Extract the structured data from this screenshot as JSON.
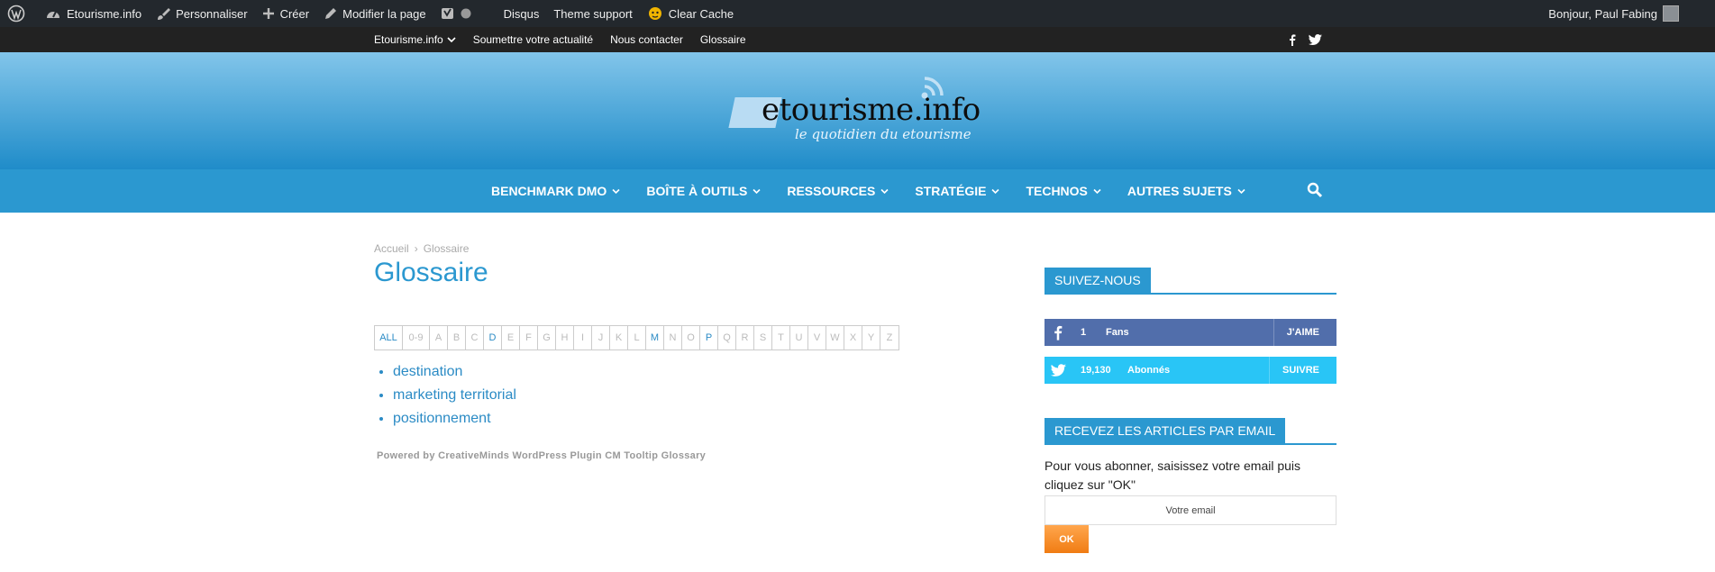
{
  "adminbar": {
    "site": "Etourisme.info",
    "customize": "Personnaliser",
    "create": "Créer",
    "edit_page": "Modifier la page",
    "disqus": "Disqus",
    "theme_support": "Theme support",
    "clear_cache": "Clear Cache",
    "greeting": "Bonjour, Paul Fabing"
  },
  "topmenu": {
    "items": [
      "Etourisme.info",
      "Soumettre votre actualité",
      "Nous contacter",
      "Glossaire"
    ]
  },
  "logo": {
    "name": "etourisme.info",
    "tagline": "le quotidien du etourisme"
  },
  "mainnav": {
    "items": [
      "BENCHMARK DMO",
      "BOÎTE À OUTILS",
      "RESSOURCES",
      "STRATÉGIE",
      "TECHNOS",
      "AUTRES SUJETS"
    ]
  },
  "breadcrumb": {
    "home": "Accueil",
    "separator": "›",
    "current": "Glossaire"
  },
  "page": {
    "title": "Glossaire"
  },
  "glossary": {
    "letters": [
      "ALL",
      "0-9",
      "A",
      "B",
      "C",
      "D",
      "E",
      "F",
      "G",
      "H",
      "I",
      "J",
      "K",
      "L",
      "M",
      "N",
      "O",
      "P",
      "Q",
      "R",
      "S",
      "T",
      "U",
      "V",
      "W",
      "X",
      "Y",
      "Z"
    ],
    "active_letters": [
      "ALL",
      "D",
      "M",
      "P"
    ],
    "terms": [
      "destination",
      "marketing territorial",
      "positionnement"
    ],
    "powered_by": "Powered by CreativeMinds WordPress Plugin CM Tooltip Glossary"
  },
  "sidebar": {
    "follow_title": "SUIVEZ-NOUS",
    "facebook": {
      "count": "1",
      "label": "Fans",
      "action": "J'AIME"
    },
    "twitter": {
      "count": "19,130",
      "label": "Abonnés",
      "action": "SUIVRE"
    },
    "email_title": "RECEVEZ LES ARTICLES PAR EMAIL",
    "email_text": "Pour vous abonner, saisissez votre email puis cliquez sur \"OK\"",
    "email_placeholder": "Votre email",
    "ok_label": "OK"
  },
  "colors": {
    "accent": "#2b98d0",
    "facebook": "#516eab",
    "twitter": "#29c5f6",
    "ok": "#f07c13",
    "adminbar": "#23282d"
  }
}
